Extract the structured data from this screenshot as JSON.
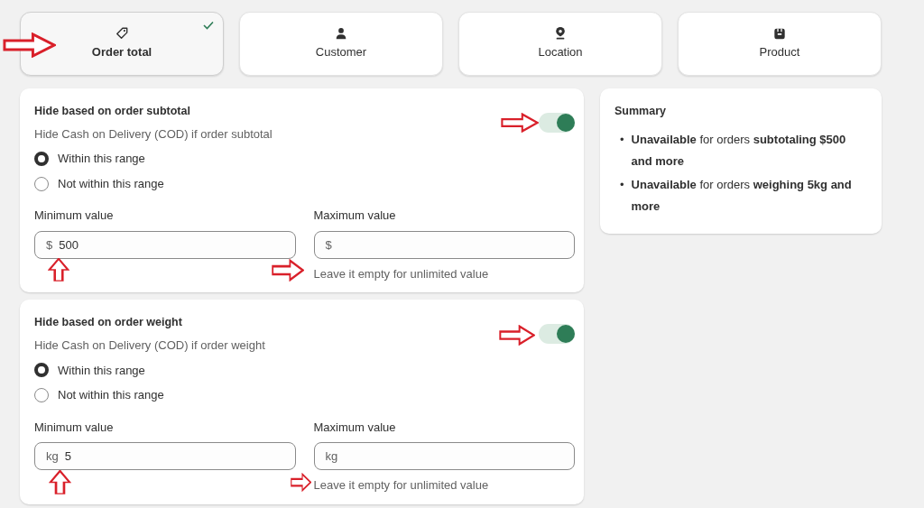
{
  "tabs": [
    {
      "label": "Order total",
      "selected": true
    },
    {
      "label": "Customer",
      "selected": false
    },
    {
      "label": "Location",
      "selected": false
    },
    {
      "label": "Product",
      "selected": false
    }
  ],
  "rules": [
    {
      "title": "Hide based on order subtotal",
      "subtitle": "Hide Cash on Delivery (COD) if order subtotal",
      "on": true,
      "options": [
        {
          "label": "Within this range",
          "selected": true
        },
        {
          "label": "Not within this range",
          "selected": false
        }
      ],
      "minimum": {
        "label": "Minimum value",
        "prefix": "$",
        "value": "500"
      },
      "maximum": {
        "label": "Maximum value",
        "prefix": "$",
        "help": "Leave it empty for unlimited value"
      }
    },
    {
      "title": "Hide based on order weight",
      "subtitle": "Hide Cash on Delivery (COD) if order weight",
      "on": true,
      "options": [
        {
          "label": "Within this range",
          "selected": true
        },
        {
          "label": "Not within this range",
          "selected": false
        }
      ],
      "minimum": {
        "label": "Minimum value",
        "prefix": "kg",
        "value": "5"
      },
      "maximum": {
        "label": "Maximum value",
        "prefix": "kg",
        "help": "Leave it empty for unlimited value"
      }
    }
  ],
  "summary": {
    "title": "Summary",
    "items": [
      {
        "bullet": "•",
        "text": "**Unavailable** for orders **subtotaling $500 and more**"
      },
      {
        "bullet": "•",
        "text": "**Unavailable** for orders **weighing 5kg and more**"
      }
    ]
  }
}
